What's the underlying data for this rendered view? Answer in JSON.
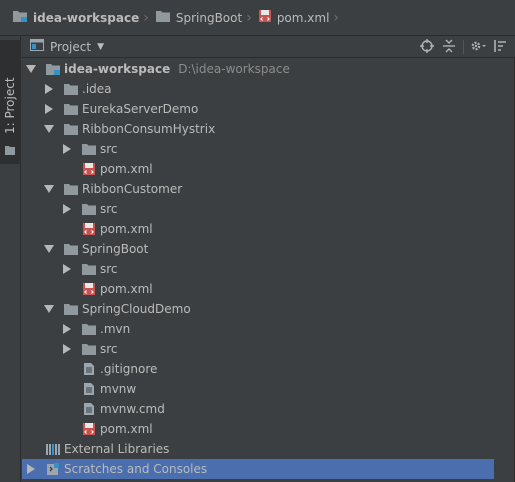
{
  "breadcrumb": {
    "items": [
      {
        "label": "idea-workspace",
        "icon": "module-folder-icon"
      },
      {
        "label": "SpringBoot",
        "icon": "folder-icon"
      },
      {
        "label": "pom.xml",
        "icon": "maven-file-icon"
      }
    ]
  },
  "toolstrip": {
    "label": "1: Project"
  },
  "panel": {
    "view_label": "Project",
    "tools": [
      "locate-icon",
      "collapse-all-icon",
      "settings-icon",
      "hide-icon"
    ]
  },
  "tree": [
    {
      "label": "idea-workspace",
      "path": "D:\\idea-workspace",
      "depth": 0,
      "arrow": "down",
      "icon": "module"
    },
    {
      "label": ".idea",
      "depth": 1,
      "arrow": "right",
      "icon": "folder"
    },
    {
      "label": "EurekaServerDemo",
      "depth": 1,
      "arrow": "right",
      "icon": "folder"
    },
    {
      "label": "RibbonConsumHystrix",
      "depth": 1,
      "arrow": "down",
      "icon": "folder"
    },
    {
      "label": "src",
      "depth": 2,
      "arrow": "right",
      "icon": "folder"
    },
    {
      "label": "pom.xml",
      "depth": 2,
      "arrow": "none",
      "icon": "maven"
    },
    {
      "label": "RibbonCustomer",
      "depth": 1,
      "arrow": "down",
      "icon": "folder"
    },
    {
      "label": "src",
      "depth": 2,
      "arrow": "right",
      "icon": "folder"
    },
    {
      "label": "pom.xml",
      "depth": 2,
      "arrow": "none",
      "icon": "maven"
    },
    {
      "label": "SpringBoot",
      "depth": 1,
      "arrow": "down",
      "icon": "folder"
    },
    {
      "label": "src",
      "depth": 2,
      "arrow": "right",
      "icon": "folder"
    },
    {
      "label": "pom.xml",
      "depth": 2,
      "arrow": "none",
      "icon": "maven"
    },
    {
      "label": "SpringCloudDemo",
      "depth": 1,
      "arrow": "down",
      "icon": "folder"
    },
    {
      "label": ".mvn",
      "depth": 2,
      "arrow": "right",
      "icon": "folder"
    },
    {
      "label": "src",
      "depth": 2,
      "arrow": "right",
      "icon": "folder"
    },
    {
      "label": ".gitignore",
      "depth": 2,
      "arrow": "none",
      "icon": "text"
    },
    {
      "label": "mvnw",
      "depth": 2,
      "arrow": "none",
      "icon": "text"
    },
    {
      "label": "mvnw.cmd",
      "depth": 2,
      "arrow": "none",
      "icon": "text"
    },
    {
      "label": "pom.xml",
      "depth": 2,
      "arrow": "none",
      "icon": "maven"
    },
    {
      "label": "External Libraries",
      "depth": 0,
      "arrow": "none",
      "icon": "libraries"
    },
    {
      "label": "Scratches and Consoles",
      "depth": 0,
      "arrow": "right",
      "icon": "scratches",
      "selected": true
    }
  ],
  "colors": {
    "background": "#3c3f41",
    "selection": "#4b6eaf",
    "folder": "#90999e",
    "module_marker": "#3592c4",
    "maven": "#c75450",
    "text": "#bbbbbb",
    "path": "#8c8c8c"
  }
}
